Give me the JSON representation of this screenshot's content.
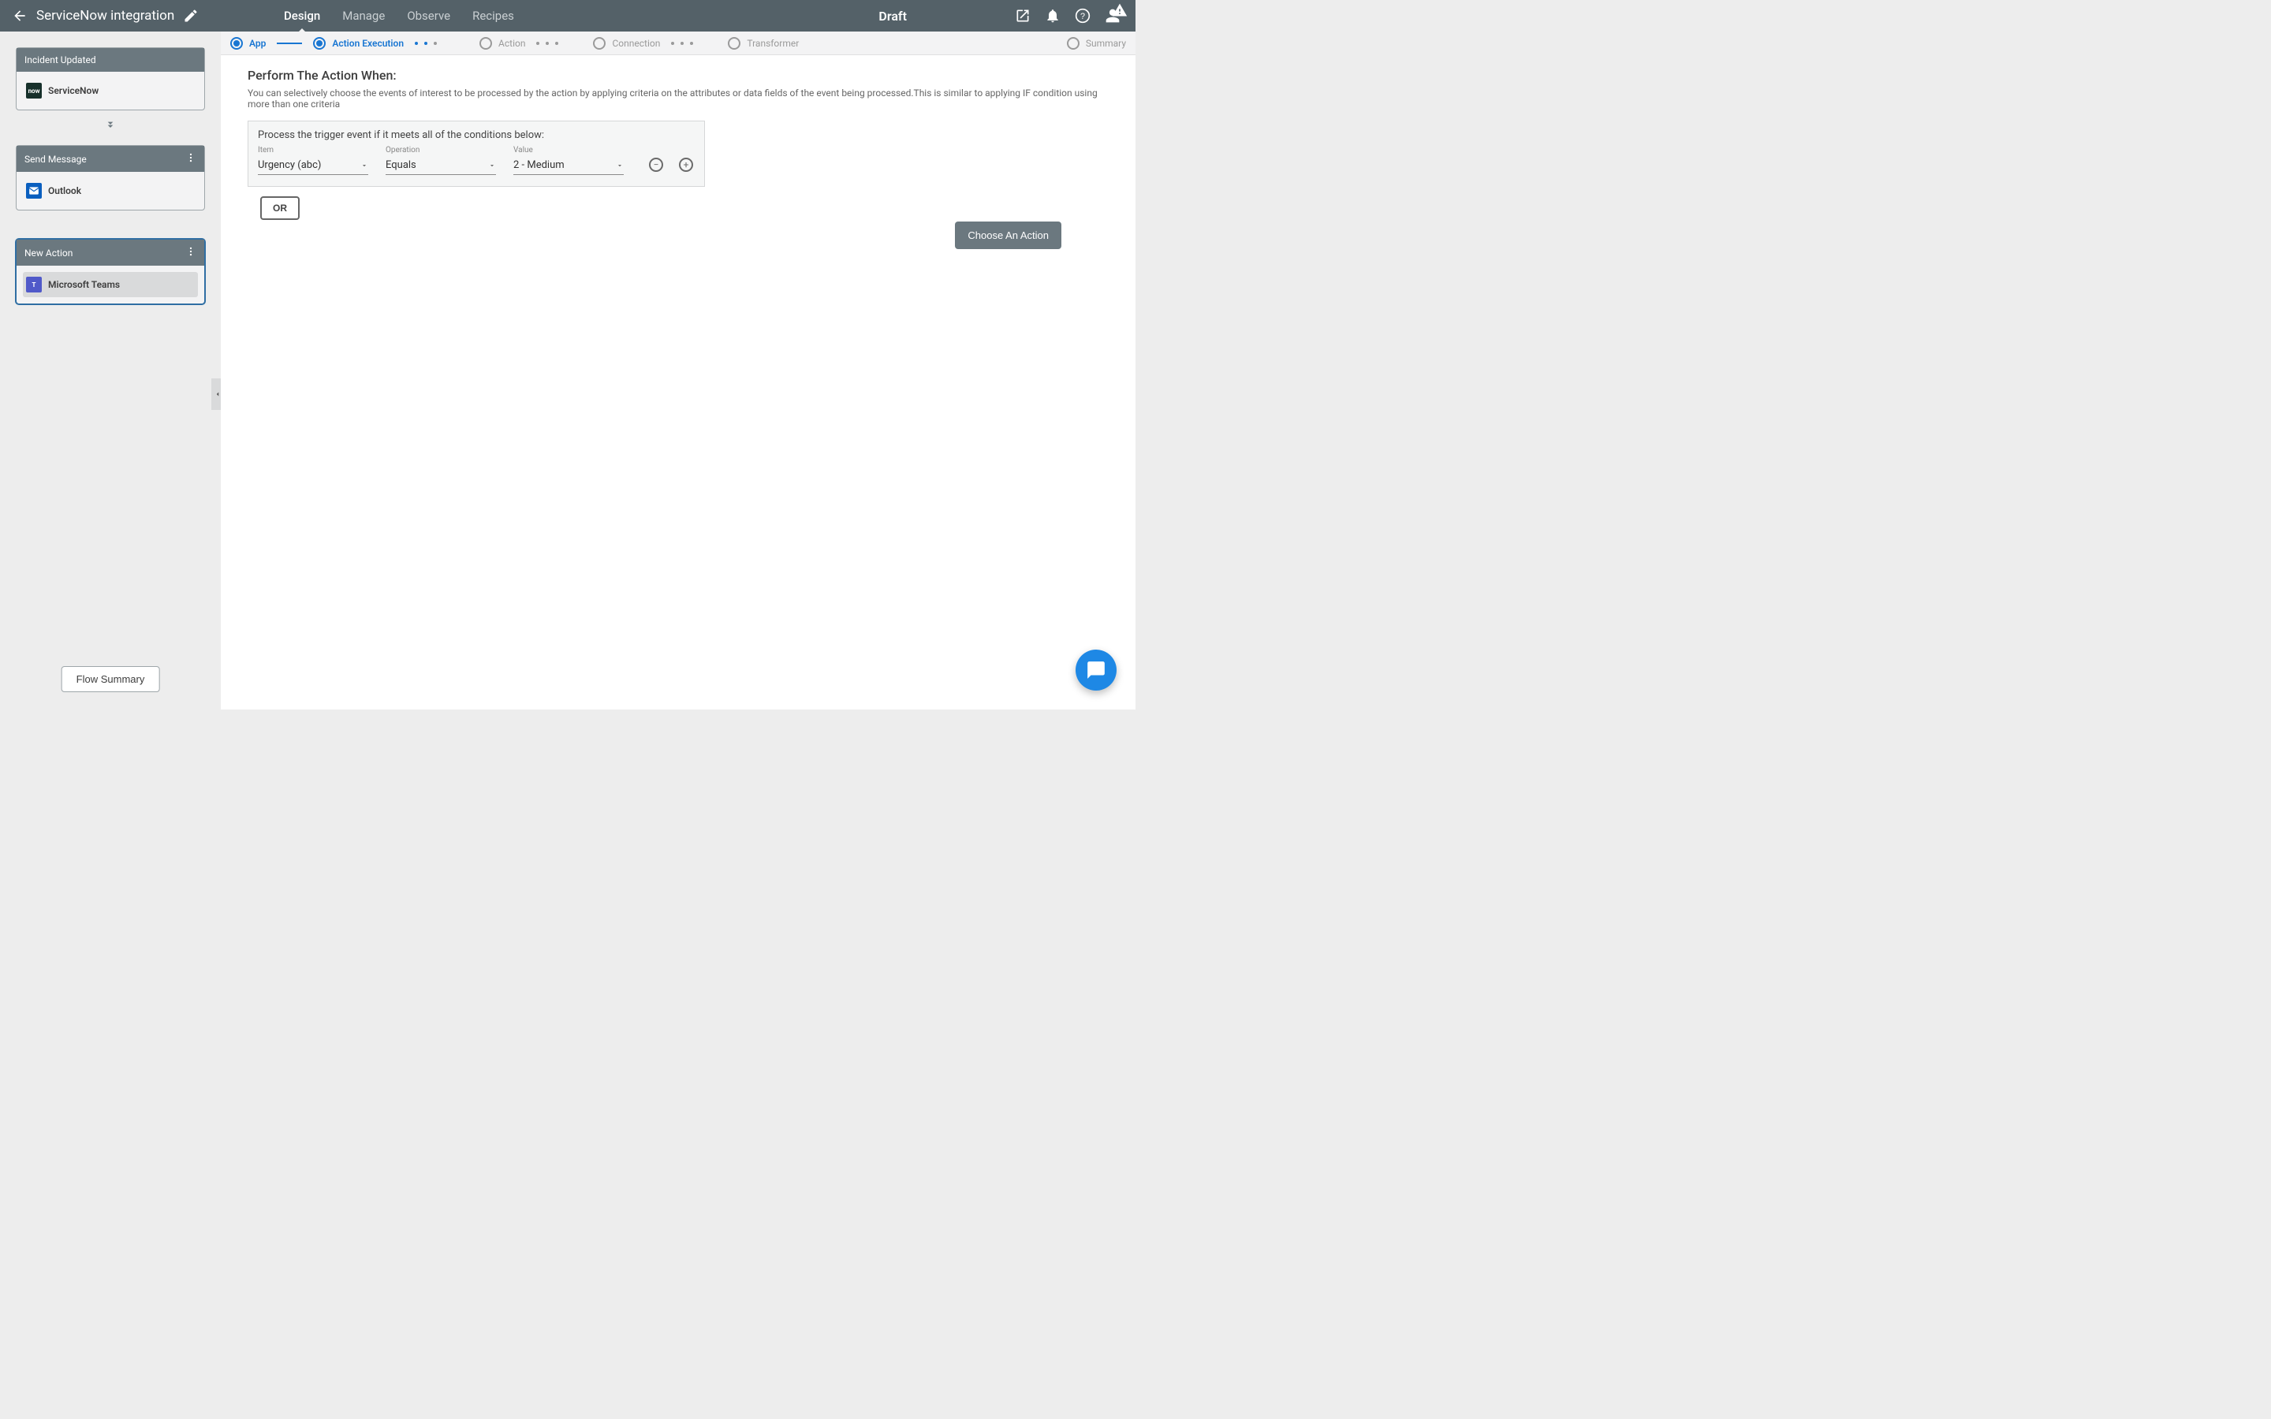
{
  "header": {
    "title": "ServiceNow integration",
    "status": "Draft",
    "nav": [
      "Design",
      "Manage",
      "Observe",
      "Recipes"
    ],
    "nav_active": "Design"
  },
  "stepper": {
    "steps": [
      "App",
      "Action Execution",
      "Action",
      "Connection",
      "Transformer",
      "Summary"
    ]
  },
  "sidebar": {
    "cards": [
      {
        "title": "Incident Updated",
        "app": "ServiceNow"
      },
      {
        "title": "Send Message",
        "app": "Outlook"
      },
      {
        "title": "New Action",
        "app": "Microsoft Teams"
      }
    ],
    "flow_summary_label": "Flow Summary"
  },
  "main": {
    "heading": "Perform The Action When:",
    "description": "You can selectively choose the events of interest to be processed by the action by applying criteria on the attributes or data fields of the event being processed.This is similar to applying IF condition using more than one criteria",
    "cond_title": "Process the trigger event if it meets all of the conditions below:",
    "fields": {
      "item_label": "Item",
      "item_value": "Urgency (abc)",
      "op_label": "Operation",
      "op_value": "Equals",
      "val_label": "Value",
      "val_value": "2 - Medium"
    },
    "or_label": "OR",
    "choose_action_label": "Choose An Action"
  }
}
